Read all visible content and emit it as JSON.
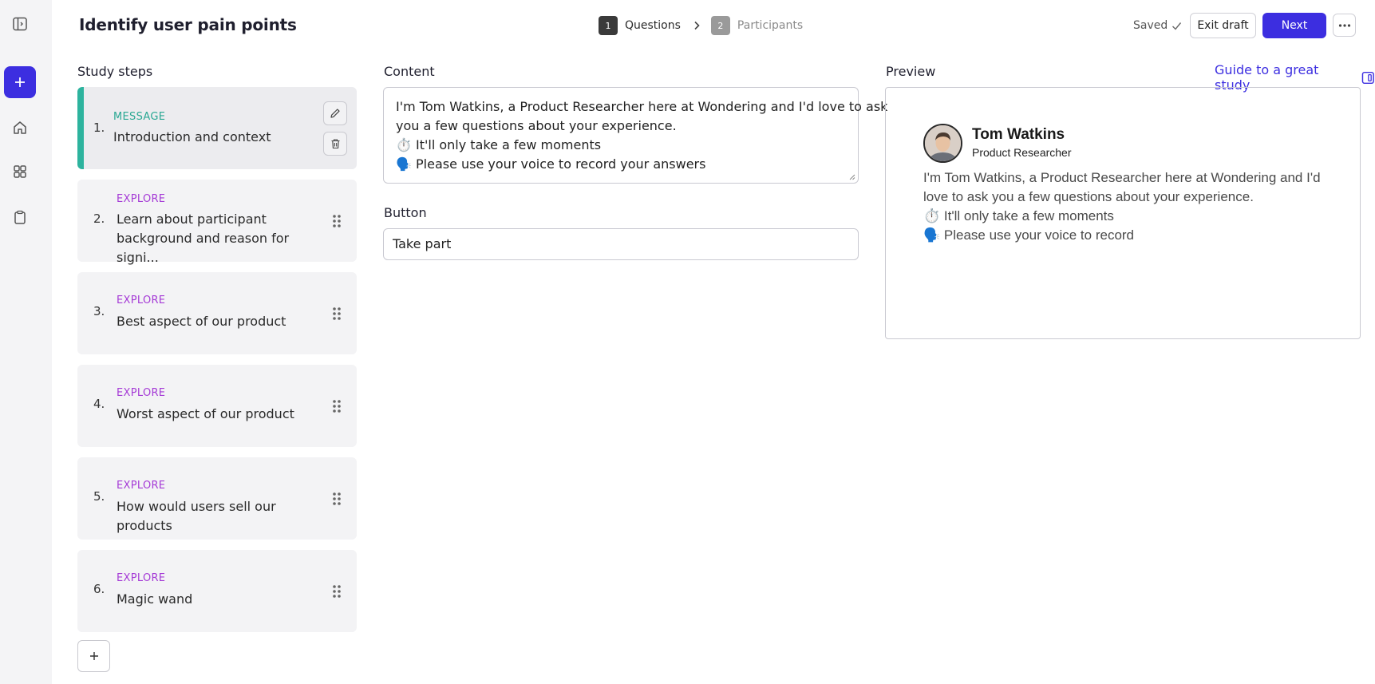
{
  "header": {
    "title": "Identify user pain points",
    "steps": [
      {
        "num": "1",
        "label": "Questions"
      },
      {
        "num": "2",
        "label": "Participants"
      }
    ],
    "saved_label": "Saved",
    "exit_label": "Exit draft",
    "next_label": "Next"
  },
  "study_steps": {
    "heading": "Study steps",
    "items": [
      {
        "num": "1.",
        "type": "MESSAGE",
        "title": "Introduction and context"
      },
      {
        "num": "2.",
        "type": "EXPLORE",
        "title": "Learn about participant background and reason for signi..."
      },
      {
        "num": "3.",
        "type": "EXPLORE",
        "title": "Best aspect of our product"
      },
      {
        "num": "4.",
        "type": "EXPLORE",
        "title": "Worst aspect of our product"
      },
      {
        "num": "5.",
        "type": "EXPLORE",
        "title": "How would users sell our products"
      },
      {
        "num": "6.",
        "type": "EXPLORE",
        "title": "Magic wand"
      }
    ]
  },
  "content": {
    "heading": "Content",
    "lines": [
      "I'm Tom Watkins, a Product Researcher here at Wondering and I'd love to ask",
      "you a few questions about your experience.",
      "⏱️ It'll only take a few moments",
      "🗣️ Please use your voice to record your answers"
    ],
    "button_heading": "Button",
    "button_value": "Take part"
  },
  "preview": {
    "heading": "Preview",
    "guide_link": "Guide to a great study",
    "name": "Tom Watkins",
    "role": "Product Researcher",
    "lines": [
      "I'm Tom Watkins, a Product Researcher here at Wondering and I'd",
      "love to ask you a few questions about your experience.",
      "⏱️ It'll only take a few moments",
      "🗣️ Please use your voice to record"
    ]
  },
  "colors": {
    "accent": "#3c2ee0",
    "message_type": "#2aa893",
    "explore_type": "#a53ad6"
  }
}
